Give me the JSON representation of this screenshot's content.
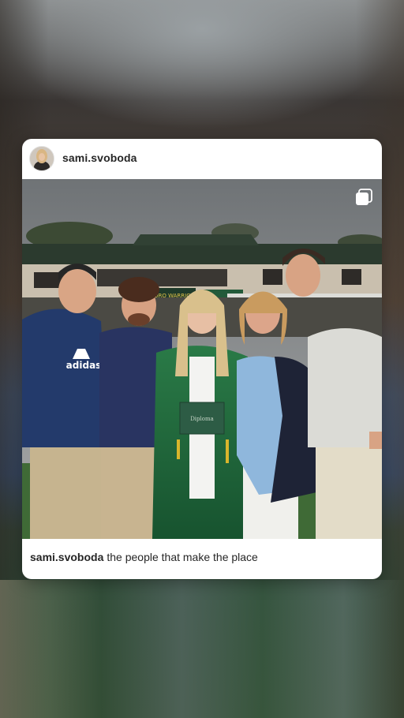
{
  "post": {
    "username": "sami.svoboda",
    "caption_username": "sami.svoboda",
    "caption_text": "the people that make the place",
    "photo_signage": "...ORO WARRIORS",
    "photo_signage_sub": "...STATE CHAMPION...",
    "diploma_text": "Diploma",
    "shirt_brand": "adidas"
  },
  "icons": {
    "multi_photo": "carousel-icon",
    "avatar": "profile-photo"
  },
  "colors": {
    "card_bg": "#ffffff",
    "text": "#262626",
    "gown_green": "#1f6b3e",
    "sky": "#8a8d90"
  }
}
